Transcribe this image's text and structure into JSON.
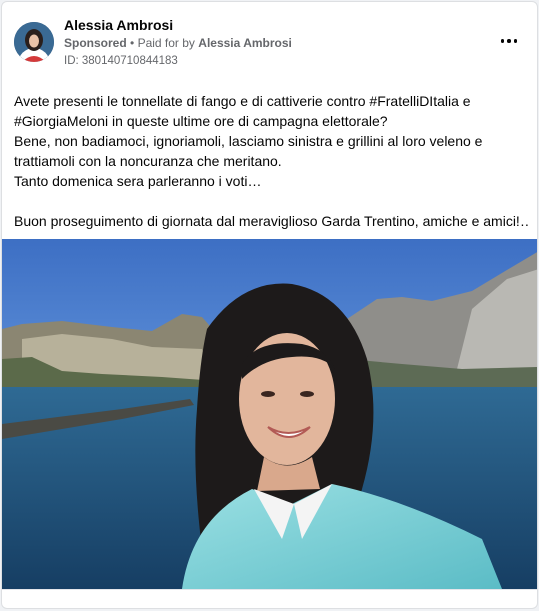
{
  "post": {
    "author": "Alessia Ambrosi",
    "sponsored": "Sponsored",
    "separator": "•",
    "paid_for_prefix": "Paid for by",
    "paid_for_name": "Alessia Ambrosi",
    "ad_id": "ID: 380140710844183",
    "text_lines": [
      "Avete presenti le tonnellate di fango e di cattiverie contro #FratelliDItalia e",
      "#GiorgiaMeloni in queste ultime ore di campagna elettorale?",
      "Bene, non badiamoci, ignoriamoli, lasciamo sinistra e grillini al loro veleno e",
      "trattiamoli con la noncuranza che meritano.",
      "Tanto domenica sera parleranno i voti…",
      "",
      "Buon proseguimento di giornata dal meraviglioso Garda Trentino, amiche e amici!…"
    ]
  },
  "icons": {
    "more": "more-options-icon"
  },
  "colors": {
    "sky_top": "#3f74c8",
    "lake": "#1e4f7a",
    "jacket": "#7fd0d6",
    "hair": "#1d1a1a",
    "text_secondary": "#65676b"
  }
}
